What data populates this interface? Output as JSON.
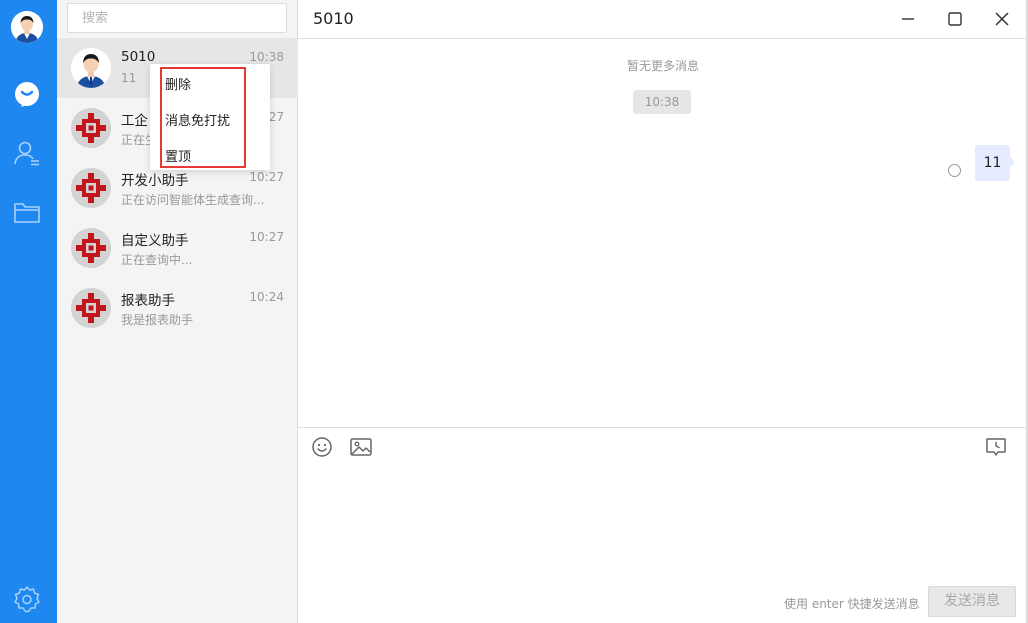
{
  "sidebar": {
    "icons": [
      "user-avatar",
      "chat-icon",
      "contacts-icon",
      "folder-icon",
      "settings-icon"
    ]
  },
  "conversation_list": {
    "search_placeholder": "搜索",
    "items": [
      {
        "name": "5010",
        "time": "10:38",
        "preview": "11",
        "avatar": "person-avatar",
        "active": true
      },
      {
        "name": "工企",
        "time": "27",
        "preview": "正在生",
        "avatar": "bot-logo-avatar"
      },
      {
        "name": "开发小助手",
        "time": "10:27",
        "preview": "正在访问智能体生成查询...",
        "avatar": "bot-logo-avatar"
      },
      {
        "name": "自定义助手",
        "time": "10:27",
        "preview": "正在查询中...",
        "avatar": "bot-logo-avatar"
      },
      {
        "name": "报表助手",
        "time": "10:24",
        "preview": "我是报表助手",
        "avatar": "bot-logo-avatar"
      }
    ]
  },
  "context_menu": {
    "items": [
      "删除",
      "消息免打扰",
      "置顶"
    ]
  },
  "chat": {
    "title": "5010",
    "no_more": "暂无更多消息",
    "time_chip": "10:38",
    "message": "11"
  },
  "input": {
    "hint": "使用 enter 快捷发送消息",
    "send_label": "发送消息"
  },
  "colors": {
    "rail": "#1e88f0",
    "highlight_border": "#e53935",
    "bubble": "#e5ecff",
    "bot_logo": "#c0171d"
  }
}
